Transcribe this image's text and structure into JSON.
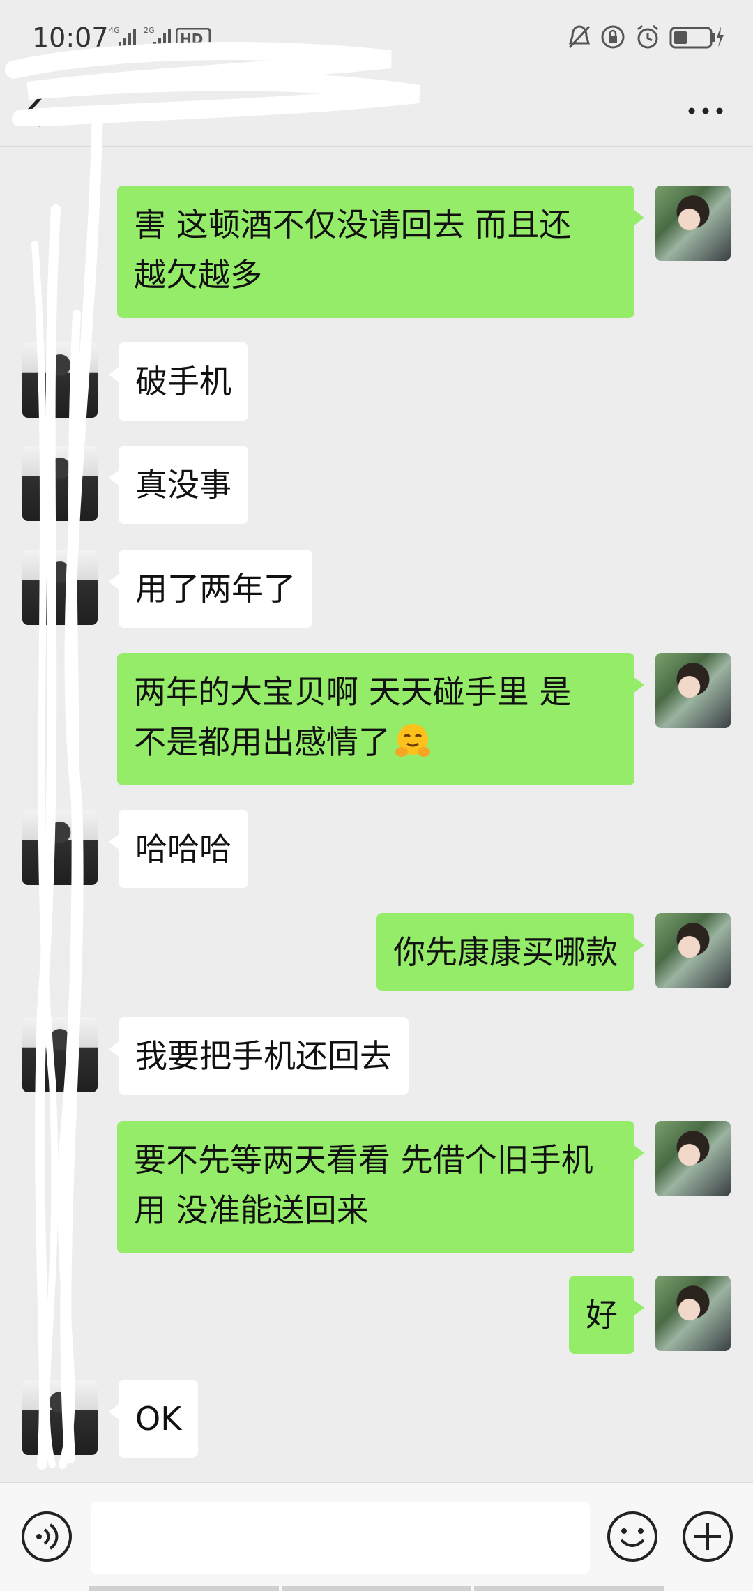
{
  "status_bar": {
    "time": "10:07",
    "network1": "4G",
    "network2": "2G",
    "hd_label": "HD"
  },
  "header": {
    "more_label": "···"
  },
  "messages": [
    {
      "from": "self",
      "lines": [
        "害 这顿酒不仅没请回去 而且还",
        "越欠越多"
      ]
    },
    {
      "from": "other",
      "lines": [
        "破手机"
      ]
    },
    {
      "from": "other",
      "lines": [
        "真没事"
      ]
    },
    {
      "from": "other",
      "lines": [
        "用了两年了"
      ]
    },
    {
      "from": "self",
      "lines": [
        "两年的大宝贝啊 天天碰手里 是",
        "不是都用出感情了"
      ],
      "emoji": "hug-face"
    },
    {
      "from": "other",
      "lines": [
        "哈哈哈"
      ]
    },
    {
      "from": "self",
      "lines": [
        "你先康康买哪款"
      ]
    },
    {
      "from": "other",
      "lines": [
        "我要把手机还回去"
      ]
    },
    {
      "from": "self",
      "lines": [
        "要不先等两天看看 先借个旧手机",
        "用 没准能送回来"
      ]
    },
    {
      "from": "self",
      "lines": [
        "好"
      ]
    },
    {
      "from": "other",
      "lines": [
        "OK"
      ]
    }
  ],
  "colors": {
    "self_bubble": "#95ec69",
    "other_bubble": "#ffffff",
    "background": "#ededed"
  }
}
